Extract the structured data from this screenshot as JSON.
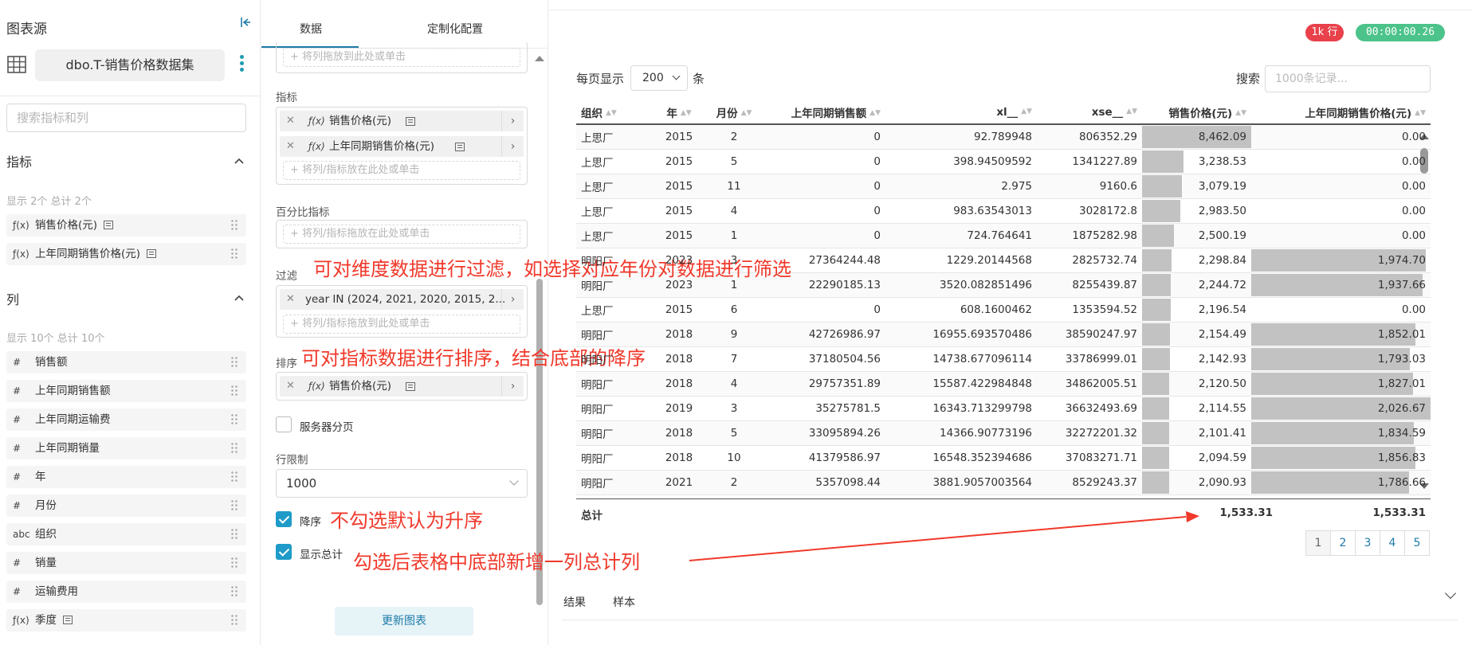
{
  "left_panel": {
    "title": "图表源",
    "dataset_name": "dbo.T-销售价格数据集",
    "search_placeholder": "搜索指标和列",
    "metrics_section": {
      "title": "指标",
      "hint": "显示 2个 总计 2个",
      "items": [
        {
          "type": "ƒ(x)",
          "label": "销售价格(元)"
        },
        {
          "type": "ƒ(x)",
          "label": "上年同期销售价格(元)"
        }
      ]
    },
    "columns_section": {
      "title": "列",
      "hint": "显示 10个 总计 10个",
      "items": [
        {
          "type": "#",
          "label": "销售额"
        },
        {
          "type": "#",
          "label": "上年同期销售额"
        },
        {
          "type": "#",
          "label": "上年同期运输费"
        },
        {
          "type": "#",
          "label": "上年同期销量"
        },
        {
          "type": "#",
          "label": "年"
        },
        {
          "type": "#",
          "label": "月份"
        },
        {
          "type": "abc",
          "label": "组织"
        },
        {
          "type": "#",
          "label": "销量"
        },
        {
          "type": "#",
          "label": "运输费用"
        },
        {
          "type": "ƒ(x)",
          "label": "季度"
        }
      ]
    }
  },
  "middle_panel": {
    "tabs": [
      "数据",
      "定制化配置"
    ],
    "top_dropzone": "将列拖放到此处或单击",
    "metrics_label": "指标",
    "metrics_chips": [
      "销售价格(元)",
      "上年同期销售价格(元)"
    ],
    "metrics_dropzone": "将列/指标放在此处或单击",
    "percent_label": "百分比指标",
    "percent_dropzone": "将列/指标拖放在此处或单击",
    "filter_label": "过滤",
    "filter_chip": "year IN (2024, 2021, 2020, 2015, 2...",
    "filter_dropzone": "将列/指标拖放到此处或单击",
    "sort_label": "排序",
    "sort_chip": "销售价格(元)",
    "server_paging_label": "服务器分页",
    "row_limit_label": "行限制",
    "row_limit_value": "1000",
    "descending_label": "降序",
    "show_total_label": "显示总计",
    "update_button": "更新图表",
    "x_glyph": "✕",
    "arrow_glyph": "›",
    "fx_glyph": "ƒ(x)",
    "plus_glyph": "+"
  },
  "right_panel": {
    "row_badge": "1k 行",
    "time_badge": "00:00:00.26",
    "per_page_prefix": "每页显示",
    "per_page_value": "200",
    "per_page_suffix": "条",
    "search_label": "搜索",
    "search_placeholder": "1000条记录...",
    "columns": [
      "组织",
      "年",
      "月份",
      "上年同期销售额",
      "xl__",
      "xse__",
      "销售价格(元)",
      "上年同期销售价格(元)"
    ],
    "rows": [
      [
        "上思厂",
        "2015",
        "2",
        "0",
        "92.789948",
        "806352.29",
        "8,462.09",
        "0.00"
      ],
      [
        "上思厂",
        "2015",
        "5",
        "0",
        "398.94509592",
        "1341227.89",
        "3,238.53",
        "0.00"
      ],
      [
        "上思厂",
        "2015",
        "11",
        "0",
        "2.975",
        "9160.6",
        "3,079.19",
        "0.00"
      ],
      [
        "上思厂",
        "2015",
        "4",
        "0",
        "983.63543013",
        "3028172.8",
        "2,983.50",
        "0.00"
      ],
      [
        "上思厂",
        "2015",
        "1",
        "0",
        "724.764641",
        "1875282.98",
        "2,500.19",
        "0.00"
      ],
      [
        "明阳厂",
        "2023",
        "3",
        "27364244.48",
        "1229.20144568",
        "2825732.74",
        "2,298.84",
        "1,974.70"
      ],
      [
        "明阳厂",
        "2023",
        "1",
        "22290185.13",
        "3520.082851496",
        "8255439.87",
        "2,244.72",
        "1,937.66"
      ],
      [
        "上思厂",
        "2015",
        "6",
        "0",
        "608.1600462",
        "1353594.52",
        "2,196.54",
        "0.00"
      ],
      [
        "明阳厂",
        "2018",
        "9",
        "42726986.97",
        "16955.693570486",
        "38590247.97",
        "2,154.49",
        "1,852.01"
      ],
      [
        "明阳厂",
        "2018",
        "7",
        "37180504.56",
        "14738.677096114",
        "33786999.01",
        "2,142.93",
        "1,793.03"
      ],
      [
        "明阳厂",
        "2018",
        "4",
        "29757351.89",
        "15587.422984848",
        "34862005.51",
        "2,120.50",
        "1,827.01"
      ],
      [
        "明阳厂",
        "2019",
        "3",
        "35275781.5",
        "16343.713299798",
        "36632493.69",
        "2,114.55",
        "2,026.67"
      ],
      [
        "明阳厂",
        "2018",
        "5",
        "33095894.26",
        "14366.90773196",
        "32272201.32",
        "2,101.41",
        "1,834.59"
      ],
      [
        "明阳厂",
        "2018",
        "10",
        "41379586.97",
        "16548.352394686",
        "37083271.71",
        "2,094.59",
        "1,856.83"
      ],
      [
        "明阳厂",
        "2021",
        "2",
        "5357098.44",
        "3881.9057003564",
        "8529243.37",
        "2,090.93",
        "1,786.66"
      ]
    ],
    "total_label": "总计",
    "total_price": "1,533.31",
    "total_prev_price": "1,533.31",
    "pages": [
      "1",
      "2",
      "3",
      "4",
      "5"
    ],
    "bottom_tabs": [
      "结果",
      "样本"
    ],
    "sort_glyph": "▲▼"
  },
  "annotations": {
    "filter_note": "可对维度数据进行过滤，如选择对应年份对数据进行筛选",
    "sort_note": "可对指标数据进行排序，结合底部的降序",
    "desc_note": "不勾选默认为升序",
    "total_note": "勾选后表格中底部新增一列总计列"
  },
  "colors": {
    "accent": "#1e9bc8",
    "badge_red": "#e8414a",
    "badge_green": "#4cc38a",
    "annotation_red": "#f0392b",
    "bar_gray": "#c2c2c2"
  }
}
